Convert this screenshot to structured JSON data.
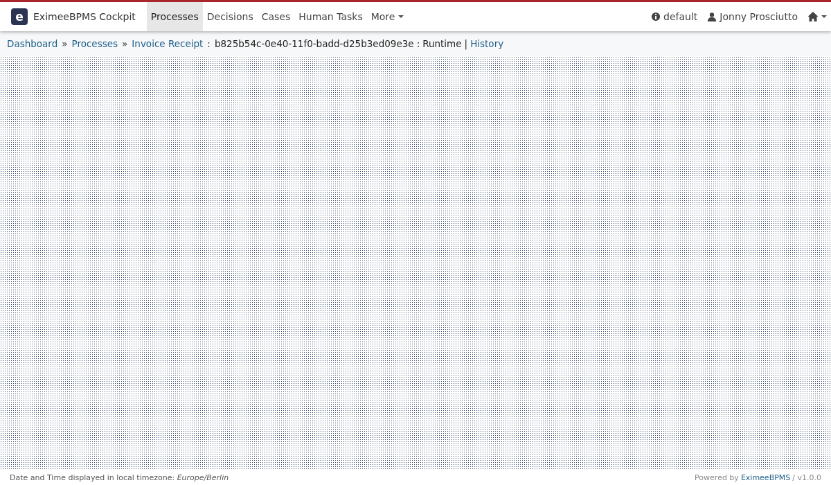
{
  "app": {
    "logo_letter": "e",
    "title": "EximeeBPMS Cockpit"
  },
  "nav": [
    {
      "label": "Processes",
      "selected": true,
      "kind": "link"
    },
    {
      "label": "Decisions",
      "selected": false,
      "kind": "link"
    },
    {
      "label": "Cases",
      "selected": false,
      "kind": "link"
    },
    {
      "label": "Human Tasks",
      "selected": false,
      "kind": "link"
    },
    {
      "label": "More",
      "selected": false,
      "kind": "dropdown"
    }
  ],
  "user_menu": {
    "engine": "default",
    "user": "Jonny Prosciutto"
  },
  "breadcrumb": [
    {
      "label": "Dashboard",
      "sep": "»"
    },
    {
      "label": "Processes",
      "sep": "»"
    },
    {
      "label": "Invoice Receipt",
      "sep": ":"
    }
  ],
  "instance": {
    "id": "b825b54c-0e40-11f0-badd-d25b3ed09e3e",
    "sep": ":",
    "view": "Runtime",
    "divider": "|",
    "other_view": "History"
  },
  "footer": {
    "timezone_text": "Date and Time displayed in local timezone:",
    "timezone": "Europe/Berlin",
    "powered_by": "Powered by",
    "brand": "EximeeBPMS",
    "version": "/ v1.0.0"
  }
}
